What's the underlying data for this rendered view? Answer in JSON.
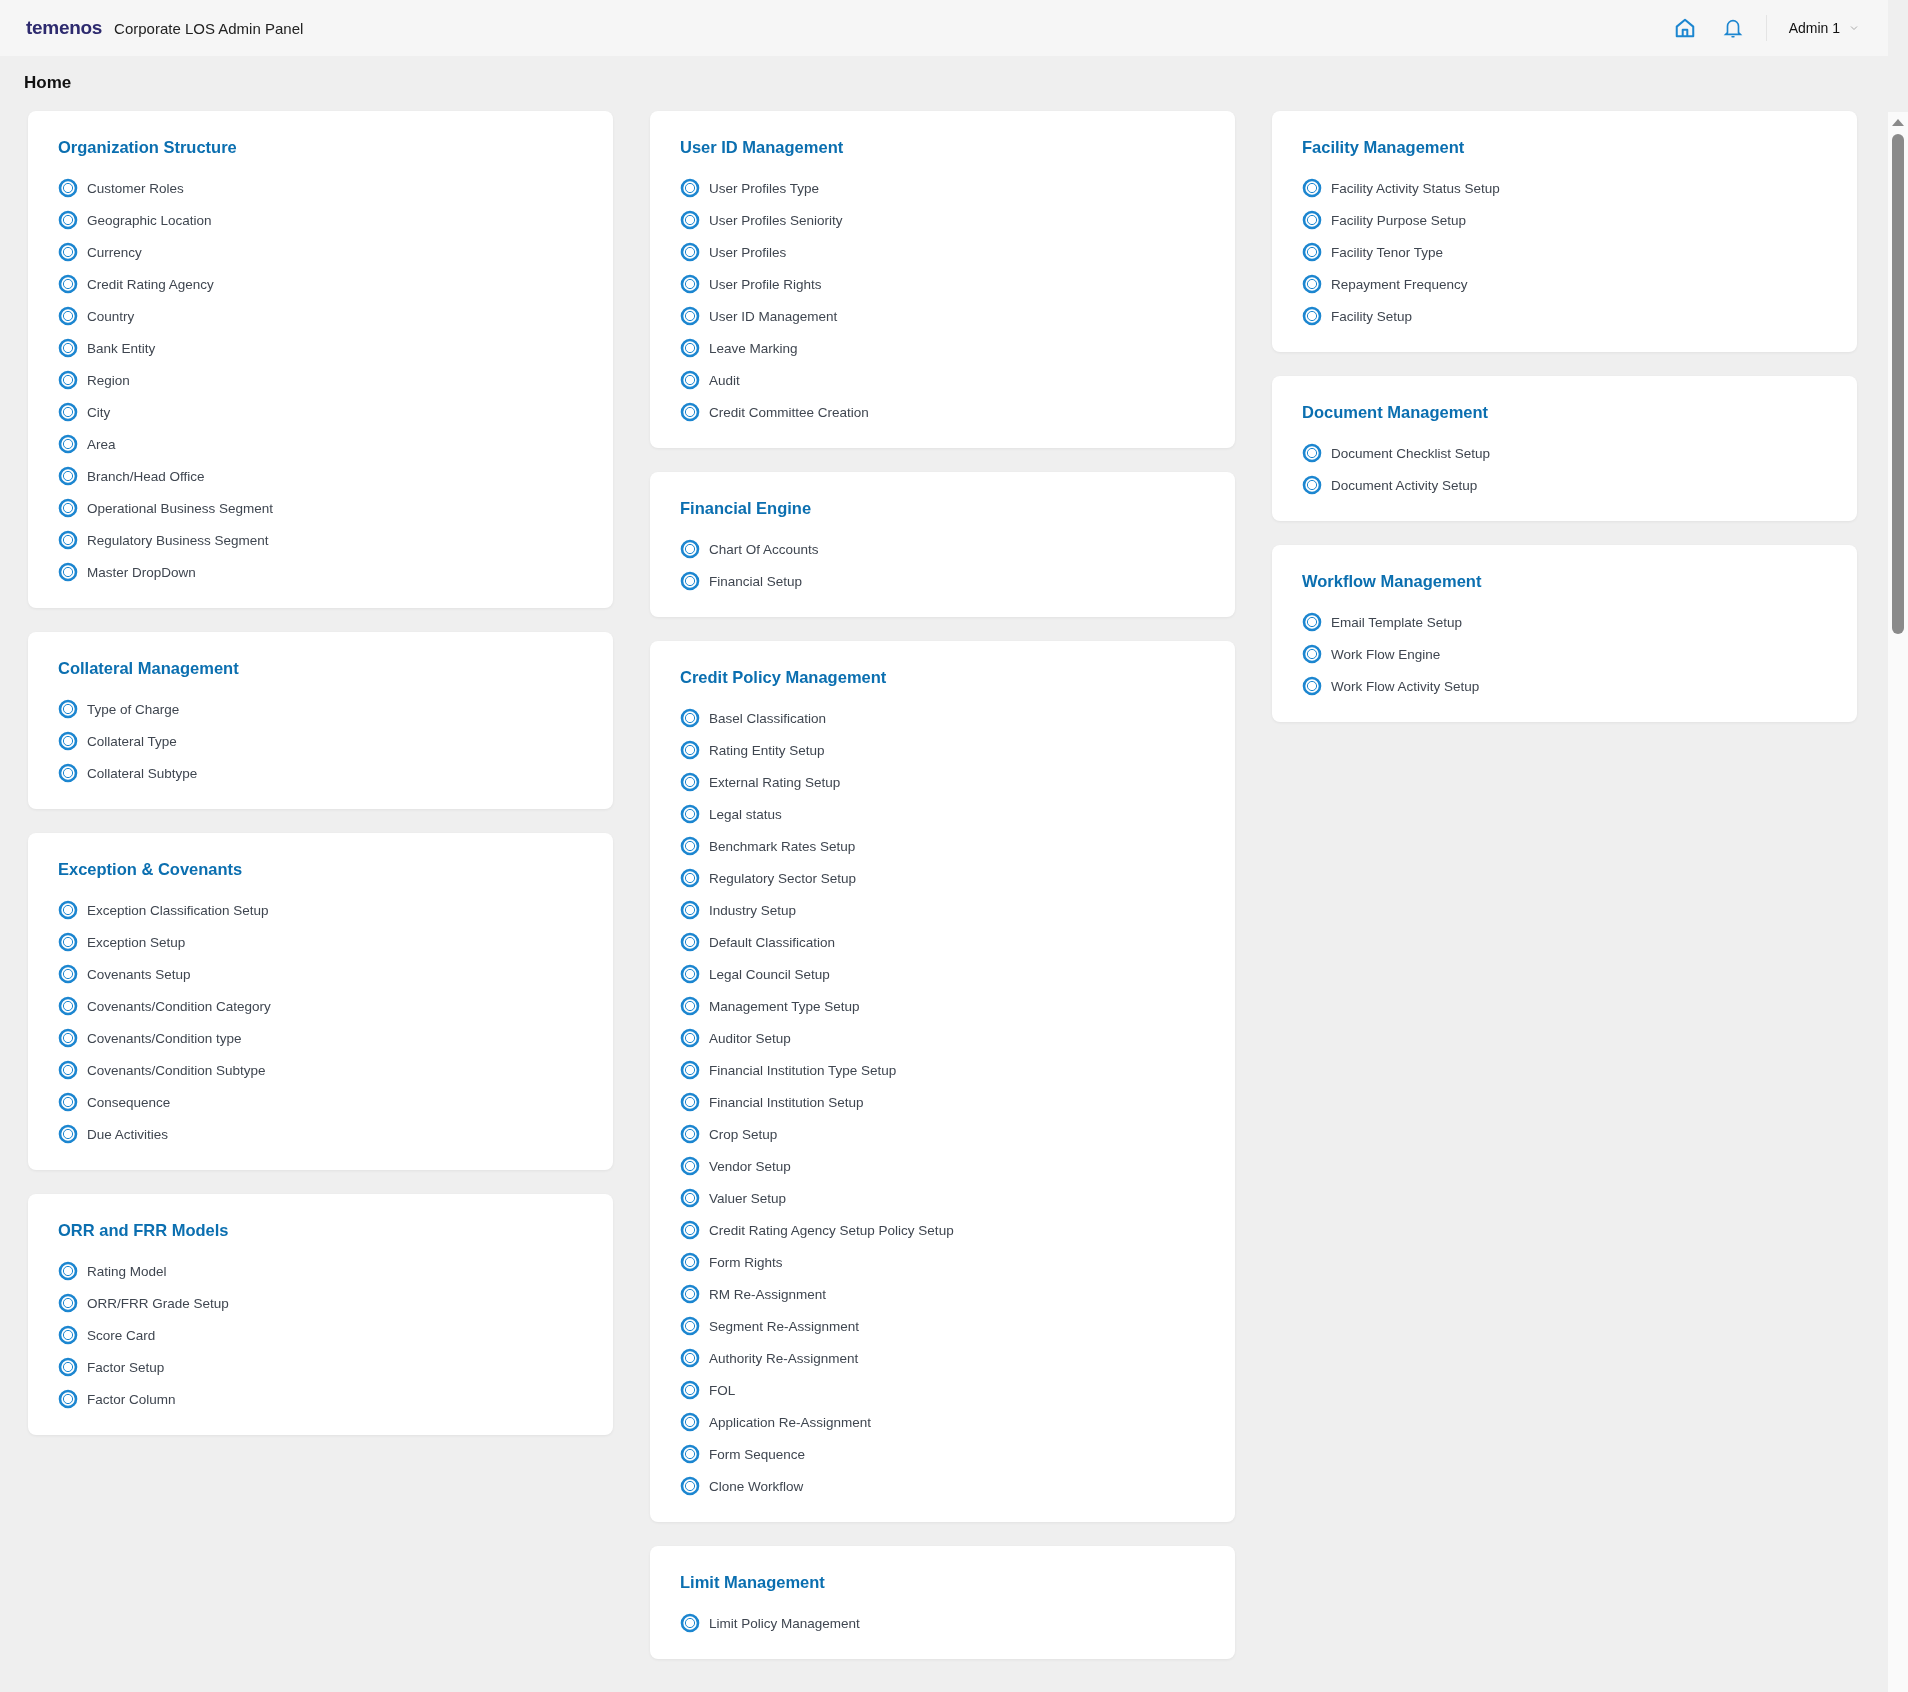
{
  "header": {
    "logo": "temenos",
    "app_title": "Corporate LOS Admin Panel",
    "user": "Admin 1"
  },
  "page_title": "Home",
  "columns": [
    {
      "sections": [
        {
          "title": "Organization Structure",
          "items": [
            "Customer Roles",
            "Geographic Location",
            "Currency",
            "Credit Rating Agency",
            "Country",
            "Bank Entity",
            "Region",
            "City",
            "Area",
            "Branch/Head Office",
            "Operational Business Segment",
            "Regulatory Business Segment",
            "Master DropDown"
          ]
        },
        {
          "title": "Collateral Management",
          "items": [
            "Type of Charge",
            "Collateral Type",
            "Collateral Subtype"
          ]
        },
        {
          "title": "Exception & Covenants",
          "items": [
            "Exception Classification Setup",
            "Exception Setup",
            "Covenants Setup",
            "Covenants/Condition Category",
            "Covenants/Condition type",
            "Covenants/Condition Subtype",
            "Consequence",
            "Due Activities"
          ]
        },
        {
          "title": "ORR and FRR Models",
          "items": [
            "Rating Model",
            "ORR/FRR Grade Setup",
            "Score Card",
            "Factor Setup",
            "Factor Column"
          ]
        }
      ]
    },
    {
      "sections": [
        {
          "title": "User ID Management",
          "items": [
            "User Profiles Type",
            "User Profiles Seniority",
            "User Profiles",
            "User Profile Rights",
            "User ID Management",
            "Leave Marking",
            "Audit",
            "Credit Committee Creation"
          ]
        },
        {
          "title": "Financial Engine",
          "items": [
            "Chart Of Accounts",
            "Financial Setup"
          ]
        },
        {
          "title": "Credit Policy Management",
          "items": [
            "Basel Classification",
            "Rating Entity Setup",
            "External Rating Setup",
            "Legal status",
            "Benchmark Rates Setup",
            "Regulatory Sector Setup",
            "Industry Setup",
            "Default Classification",
            "Legal Council Setup",
            "Management Type Setup",
            "Auditor Setup",
            "Financial Institution Type Setup",
            "Financial Institution Setup",
            "Crop Setup",
            "Vendor Setup",
            "Valuer Setup",
            "Credit Rating Agency Setup Policy Setup",
            "Form Rights",
            "RM Re-Assignment",
            "Segment Re-Assignment",
            "Authority Re-Assignment",
            "FOL",
            "Application Re-Assignment",
            "Form Sequence",
            "Clone Workflow"
          ]
        },
        {
          "title": "Limit Management",
          "items": [
            "Limit Policy Management"
          ]
        }
      ]
    },
    {
      "sections": [
        {
          "title": "Facility Management",
          "items": [
            "Facility Activity Status Setup",
            "Facility Purpose Setup",
            "Facility Tenor Type",
            "Repayment Frequency",
            "Facility Setup"
          ]
        },
        {
          "title": "Document Management",
          "items": [
            "Document Checklist Setup",
            "Document Activity Setup"
          ]
        },
        {
          "title": "Workflow Management",
          "items": [
            "Email Template Setup",
            "Work Flow Engine",
            "Work Flow Activity Setup"
          ]
        }
      ]
    }
  ]
}
